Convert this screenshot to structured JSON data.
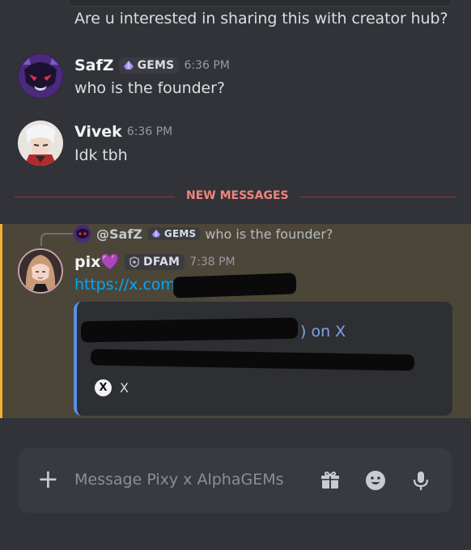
{
  "previous_message": {
    "text": "Are u interested in sharing this with creator hub?"
  },
  "messages": [
    {
      "author": "SafZ",
      "role_tag": "GEMS",
      "time": "6:36 PM",
      "text": "who is the founder?"
    },
    {
      "author": "Vivek",
      "time": "6:36 PM",
      "text": "Idk tbh"
    }
  ],
  "divider": {
    "label": "NEW MESSAGES"
  },
  "highlighted_message": {
    "reply": {
      "author": "@SafZ",
      "role_tag": "GEMS",
      "text": "who is the founder?"
    },
    "author": "pix",
    "author_emoji": "💜",
    "role_tag": "DFAM",
    "time": "7:38 PM",
    "link_text": "https://x.com/",
    "embed": {
      "title_suffix": ") on X",
      "footer_icon": "X",
      "footer_text": "X"
    }
  },
  "composer": {
    "placeholder": "Message Pixy x AlphaGEMs",
    "plus_icon": "+"
  },
  "colors": {
    "background": "#313338",
    "highlight": "#4c4638",
    "highlight_border": "#f0b232",
    "new_messages_red": "#f0847d",
    "link_blue": "#00a8fc"
  }
}
